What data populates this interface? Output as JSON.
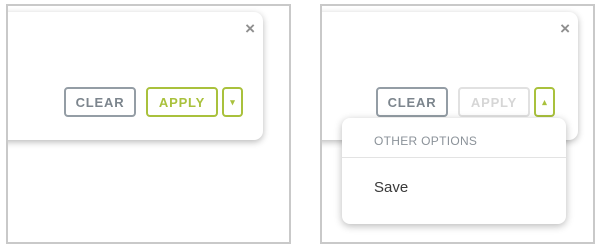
{
  "left_panel": {
    "close_glyph": "×",
    "clear_label": "CLEAR",
    "apply_label": "APPLY",
    "caret_glyph": "▾"
  },
  "right_panel": {
    "close_glyph": "×",
    "clear_label": "CLEAR",
    "apply_label": "APPLY",
    "caret_glyph": "▴",
    "dropdown": {
      "header": "OTHER OPTIONS",
      "items": [
        {
          "label": "Save"
        }
      ]
    }
  },
  "colors": {
    "accent": "#a9c13c",
    "clear_border": "#949da5",
    "disabled": "#d6d6d6",
    "panel_border": "#c9c9c9"
  },
  "icons": {
    "close": "close-icon",
    "caret_down": "chevron-down-icon",
    "caret_up": "chevron-up-icon"
  }
}
